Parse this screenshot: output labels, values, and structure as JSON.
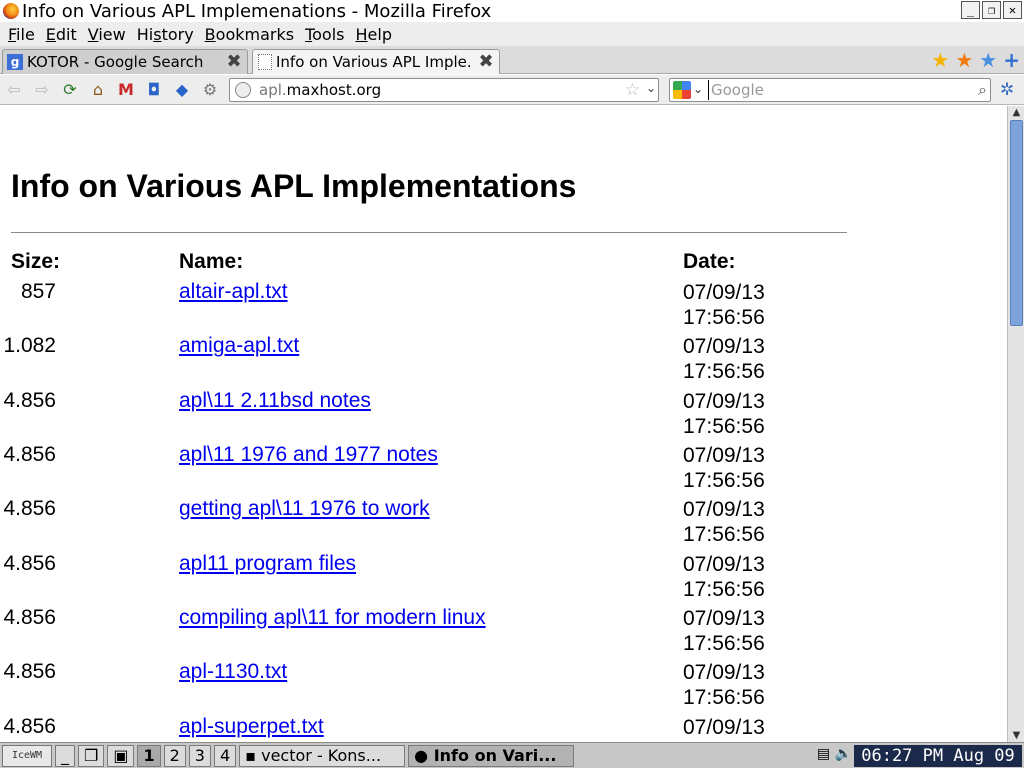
{
  "window": {
    "title": "Info on Various APL Implemenations - Mozilla Firefox"
  },
  "menu": {
    "items": [
      {
        "pre": "",
        "u": "F",
        "post": "ile"
      },
      {
        "pre": "",
        "u": "E",
        "post": "dit"
      },
      {
        "pre": "",
        "u": "V",
        "post": "iew"
      },
      {
        "pre": "Hi",
        "u": "s",
        "post": "tory"
      },
      {
        "pre": "",
        "u": "B",
        "post": "ookmarks"
      },
      {
        "pre": "",
        "u": "T",
        "post": "ools"
      },
      {
        "pre": "",
        "u": "H",
        "post": "elp"
      }
    ]
  },
  "tabs": [
    {
      "label": "KOTOR - Google Search",
      "active": false
    },
    {
      "label": "Info on Various APL Imple...",
      "active": true
    }
  ],
  "urlbar": {
    "prefix": "apl.",
    "domain": "maxhost.org"
  },
  "search": {
    "placeholder": "Google",
    "value": ""
  },
  "page": {
    "heading": "Info on Various APL Implementations",
    "col_size": "Size:",
    "col_name": "Name:",
    "col_date": "Date:",
    "files": [
      {
        "size": "857",
        "name": "altair-apl.txt",
        "date": "07/09/13",
        "time": "17:56:56"
      },
      {
        "size": "1.082",
        "name": "amiga-apl.txt",
        "date": "07/09/13",
        "time": "17:56:56"
      },
      {
        "size": "4.856",
        "name": "apl\\11 2.11bsd notes",
        "date": "07/09/13",
        "time": "17:56:56"
      },
      {
        "size": "4.856",
        "name": "apl\\11 1976 and 1977 notes",
        "date": "07/09/13",
        "time": "17:56:56"
      },
      {
        "size": "4.856",
        "name": "getting apl\\11 1976 to work",
        "date": "07/09/13",
        "time": "17:56:56"
      },
      {
        "size": "4.856",
        "name": "apl11 program files",
        "date": "07/09/13",
        "time": "17:56:56"
      },
      {
        "size": "4.856",
        "name": "compiling apl\\11 for modern linux",
        "date": "07/09/13",
        "time": "17:56:56"
      },
      {
        "size": "4.856",
        "name": "apl-1130.txt",
        "date": "07/09/13",
        "time": "17:56:56"
      },
      {
        "size": "4.856",
        "name": "apl-superpet.txt",
        "date": "07/09/13",
        "time": ""
      }
    ]
  },
  "taskbar": {
    "start_label": "IceWM",
    "desktops": [
      "1",
      "2",
      "3",
      "4"
    ],
    "windows": [
      {
        "label": "vector - Kons...",
        "active": false
      },
      {
        "label": "Info on Vari...",
        "active": true
      }
    ],
    "clock": "06:27 PM Aug 09"
  },
  "colors": {
    "link": "#0000ee",
    "clock_bg": "#1b2a4a",
    "scroll_thumb": "#7ea3dc"
  }
}
